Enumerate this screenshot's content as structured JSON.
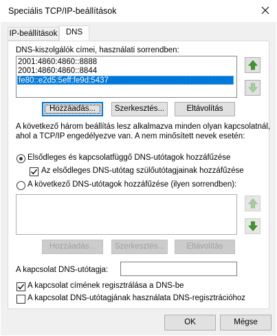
{
  "window": {
    "title": "Speciális TCP/IP-beállítások"
  },
  "tabs": [
    {
      "label": "IP-beállítások",
      "active": false
    },
    {
      "label": "DNS",
      "active": true
    }
  ],
  "dns_servers": {
    "label": "DNS-kiszolgálók címei, használati sorrendben:",
    "items": [
      "2001:4860:4860::8888",
      "2001:4860:4860::8844",
      "fe80::e2d5:5eff:fe9d:5437"
    ],
    "selected_index": 2,
    "add_label": "Hozzáadás...",
    "edit_label": "Szerkesztés...",
    "remove_label": "Eltávolítás"
  },
  "description": {
    "line1": "A következő három beállítás lesz alkalmazva minden olyan kapcsolatnál,",
    "line2": "ahol a TCP/IP engedélyezve van. A nem minősített nevek esetén:"
  },
  "options": {
    "primary_radio_label": "Elsődleges és kapcsolatfüggő DNS-utótagok hozzáfűzése",
    "primary_radio_checked": true,
    "parent_suffix_label": "Az elsődleges DNS-utótag szülőutótagjainak hozzáfűzése",
    "parent_suffix_checked": true,
    "listed_radio_label": "A következő DNS-utótagok hozzáfűzése (ilyen sorrendben):",
    "listed_radio_checked": false
  },
  "suffix_list": {
    "items": [],
    "add_label": "Hozzáadás...",
    "edit_label": "Szerkesztés...",
    "remove_label": "Eltávolítás"
  },
  "connection_suffix": {
    "label": "A kapcsolat DNS-utótagja:",
    "value": ""
  },
  "register": {
    "register_label": "A kapcsolat címének regisztrálása a DNS-be",
    "register_checked": true,
    "use_suffix_label": "A kapcsolat DNS-utótagjának használata DNS-regisztrációhoz",
    "use_suffix_checked": false
  },
  "footer": {
    "ok_label": "OK",
    "cancel_label": "Mégse"
  },
  "colors": {
    "accent": "#0078d7",
    "arrow_green": "#3a9a2a",
    "arrow_disabled": "#a3cf9a"
  },
  "icons": {
    "close": "close-icon",
    "up": "arrow-up-icon",
    "down": "arrow-down-icon",
    "check": "checkmark-icon"
  }
}
